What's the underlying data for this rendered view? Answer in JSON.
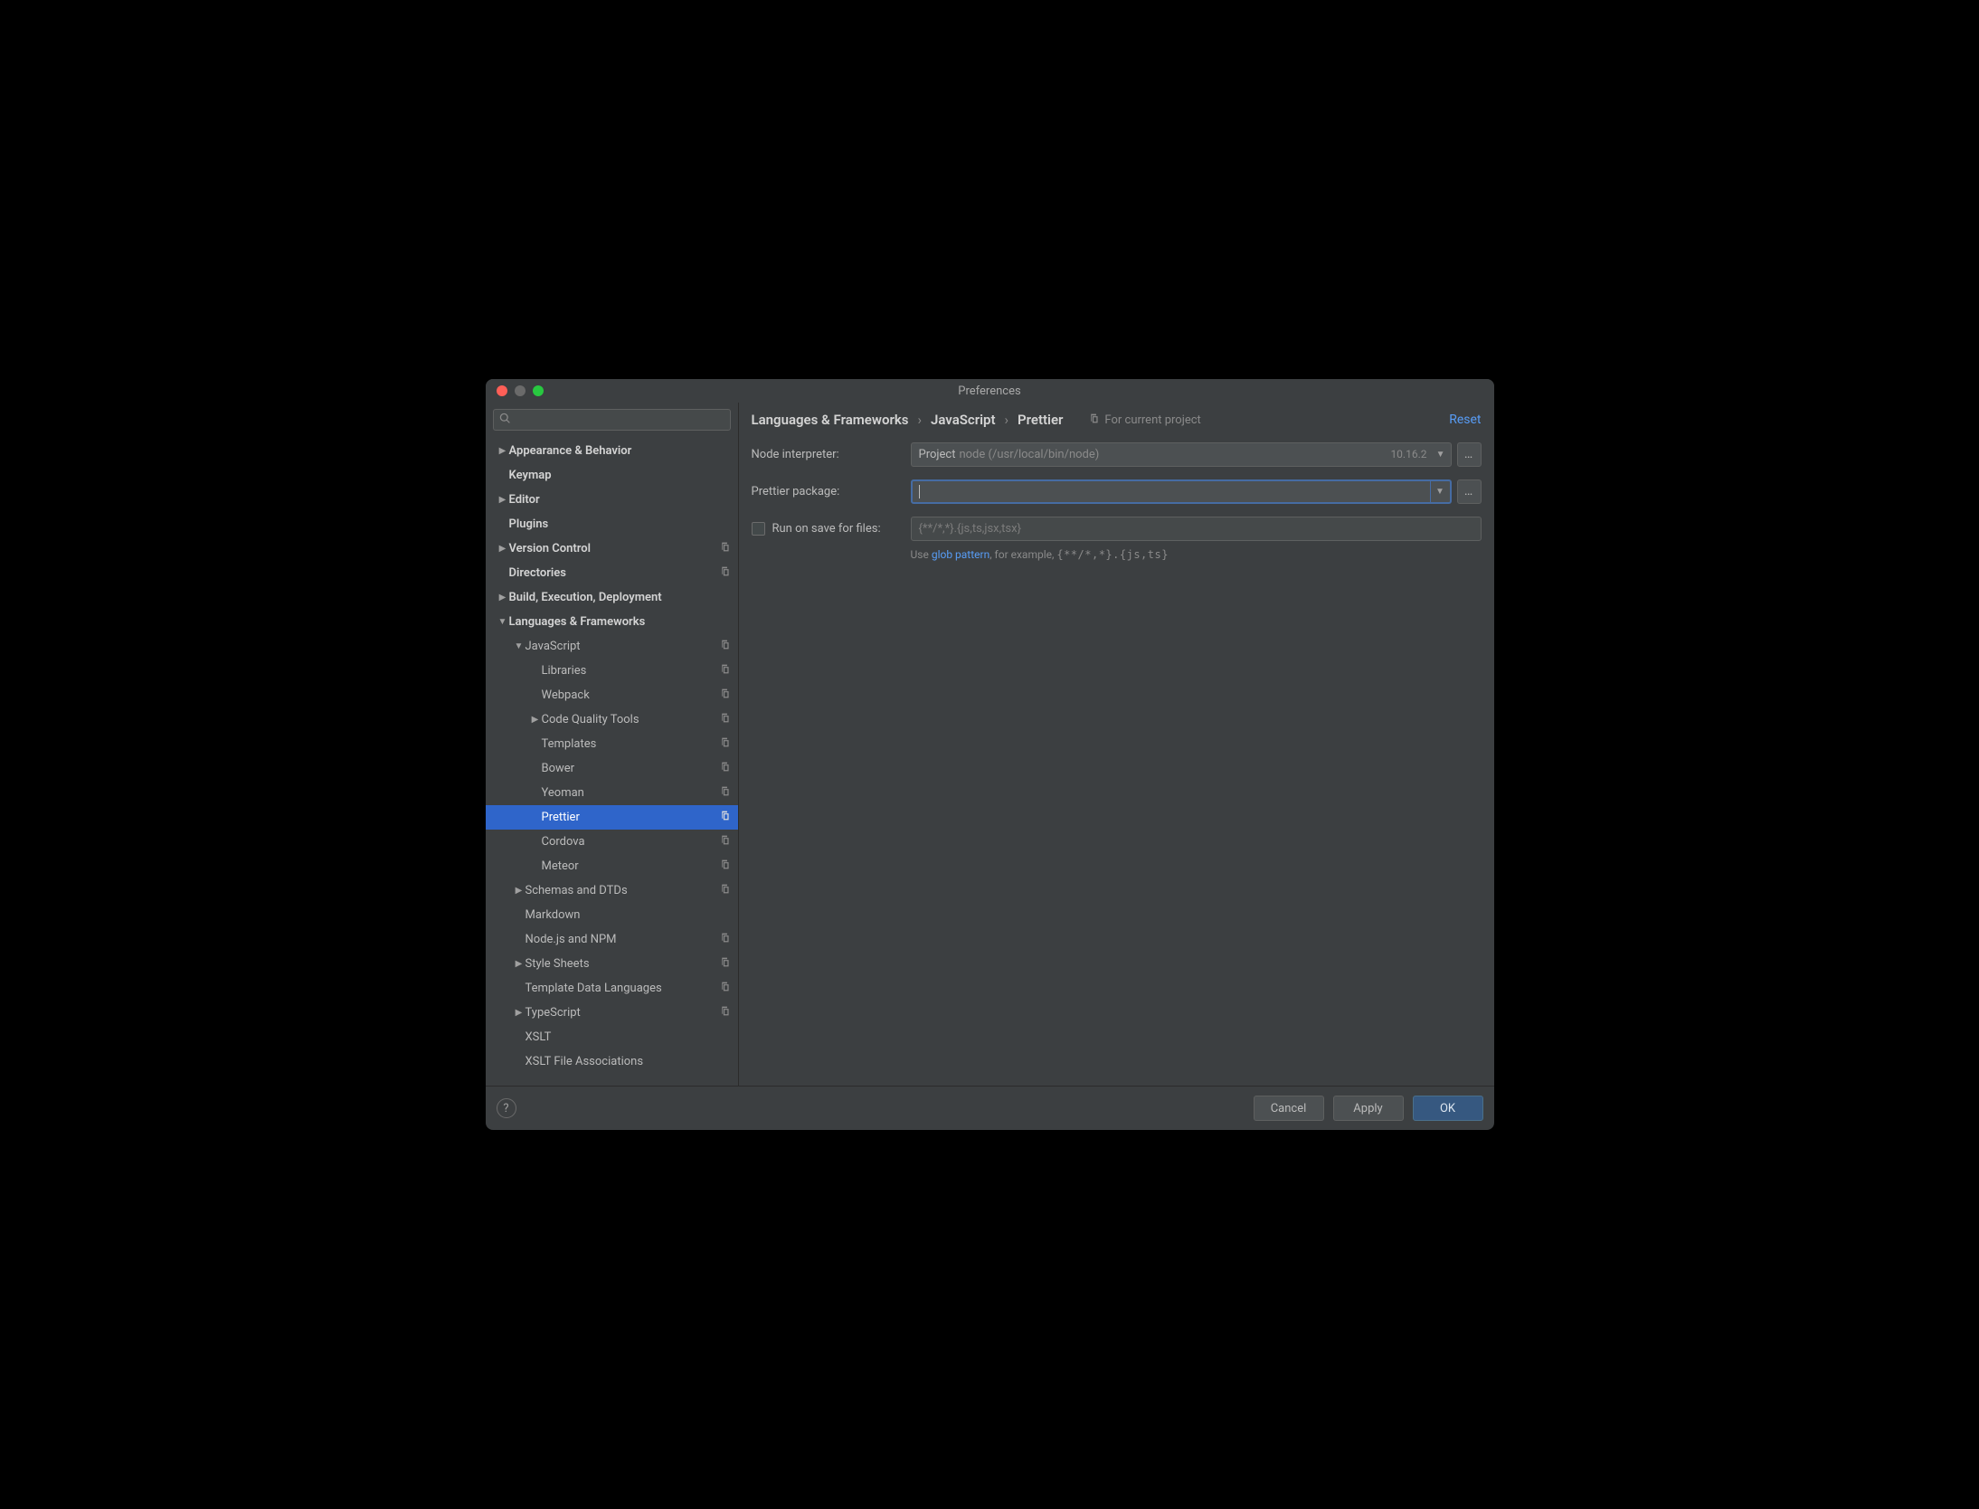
{
  "title": "Preferences",
  "breadcrumb": [
    "Languages & Frameworks",
    "JavaScript",
    "Prettier"
  ],
  "scope": "For current project",
  "reset": "Reset",
  "sidebar": [
    {
      "label": "Appearance & Behavior",
      "bold": true,
      "arrow": "right",
      "indent": 0,
      "copy": false
    },
    {
      "label": "Keymap",
      "bold": true,
      "arrow": "",
      "indent": 0,
      "copy": false
    },
    {
      "label": "Editor",
      "bold": true,
      "arrow": "right",
      "indent": 0,
      "copy": false
    },
    {
      "label": "Plugins",
      "bold": true,
      "arrow": "",
      "indent": 0,
      "copy": false
    },
    {
      "label": "Version Control",
      "bold": true,
      "arrow": "right",
      "indent": 0,
      "copy": true
    },
    {
      "label": "Directories",
      "bold": true,
      "arrow": "",
      "indent": 0,
      "copy": true
    },
    {
      "label": "Build, Execution, Deployment",
      "bold": true,
      "arrow": "right",
      "indent": 0,
      "copy": false
    },
    {
      "label": "Languages & Frameworks",
      "bold": true,
      "arrow": "down",
      "indent": 0,
      "copy": false
    },
    {
      "label": "JavaScript",
      "bold": false,
      "arrow": "down",
      "indent": 1,
      "copy": true
    },
    {
      "label": "Libraries",
      "bold": false,
      "arrow": "",
      "indent": 2,
      "copy": true
    },
    {
      "label": "Webpack",
      "bold": false,
      "arrow": "",
      "indent": 2,
      "copy": true
    },
    {
      "label": "Code Quality Tools",
      "bold": false,
      "arrow": "right",
      "indent": 2,
      "copy": true
    },
    {
      "label": "Templates",
      "bold": false,
      "arrow": "",
      "indent": 2,
      "copy": true
    },
    {
      "label": "Bower",
      "bold": false,
      "arrow": "",
      "indent": 2,
      "copy": true
    },
    {
      "label": "Yeoman",
      "bold": false,
      "arrow": "",
      "indent": 2,
      "copy": true
    },
    {
      "label": "Prettier",
      "bold": false,
      "arrow": "",
      "indent": 2,
      "copy": true,
      "selected": true
    },
    {
      "label": "Cordova",
      "bold": false,
      "arrow": "",
      "indent": 2,
      "copy": true
    },
    {
      "label": "Meteor",
      "bold": false,
      "arrow": "",
      "indent": 2,
      "copy": true
    },
    {
      "label": "Schemas and DTDs",
      "bold": false,
      "arrow": "right",
      "indent": 1,
      "copy": true
    },
    {
      "label": "Markdown",
      "bold": false,
      "arrow": "",
      "indent": 1,
      "copy": false
    },
    {
      "label": "Node.js and NPM",
      "bold": false,
      "arrow": "",
      "indent": 1,
      "copy": true
    },
    {
      "label": "Style Sheets",
      "bold": false,
      "arrow": "right",
      "indent": 1,
      "copy": true
    },
    {
      "label": "Template Data Languages",
      "bold": false,
      "arrow": "",
      "indent": 1,
      "copy": true
    },
    {
      "label": "TypeScript",
      "bold": false,
      "arrow": "right",
      "indent": 1,
      "copy": true
    },
    {
      "label": "XSLT",
      "bold": false,
      "arrow": "",
      "indent": 1,
      "copy": false
    },
    {
      "label": "XSLT File Associations",
      "bold": false,
      "arrow": "",
      "indent": 1,
      "copy": false
    }
  ],
  "form": {
    "node_label": "Node interpreter:",
    "node_project": "Project",
    "node_path": "node (/usr/local/bin/node)",
    "node_version": "10.16.2",
    "package_label": "Prettier package:",
    "run_label": "Run on save for files:",
    "run_placeholder": "{**/*,*}.{js,ts,jsx,tsx}",
    "hint_prefix": "Use ",
    "hint_link": "glob pattern",
    "hint_suffix": ", for example, ",
    "hint_code": "{**/*,*}.{js,ts}"
  },
  "footer": {
    "cancel": "Cancel",
    "apply": "Apply",
    "ok": "OK"
  }
}
